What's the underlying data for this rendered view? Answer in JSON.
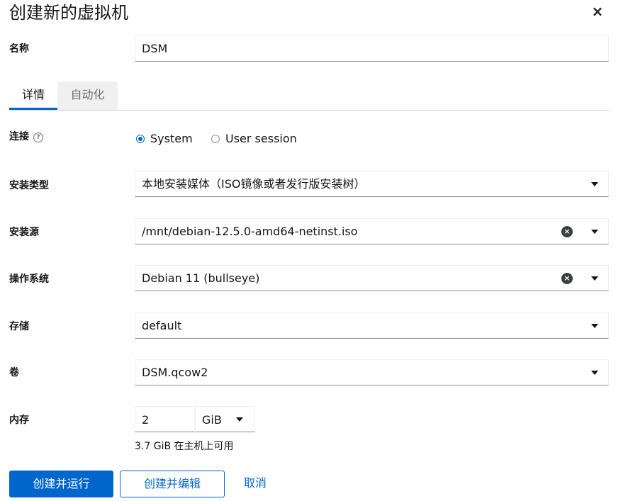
{
  "dialog": {
    "title": "创建新的虚拟机",
    "close_icon": "×"
  },
  "name": {
    "label": "名称",
    "value": "DSM"
  },
  "tabs": [
    {
      "label": "详情",
      "active": true
    },
    {
      "label": "自动化",
      "active": false
    }
  ],
  "connection": {
    "label": "连接",
    "help_icon": "?",
    "options": [
      {
        "label": "System",
        "checked": true
      },
      {
        "label": "User session",
        "checked": false
      }
    ]
  },
  "install_type": {
    "label": "安装类型",
    "value": "本地安装媒体（ISO镜像或者发行版安装树）"
  },
  "install_source": {
    "label": "安装源",
    "value": "/mnt/debian-12.5.0-amd64-netinst.iso"
  },
  "os": {
    "label": "操作系统",
    "value": "Debian 11 (bullseye)"
  },
  "storage": {
    "label": "存储",
    "value": "default"
  },
  "volume": {
    "label": "卷",
    "value": "DSM.qcow2"
  },
  "memory": {
    "label": "内存",
    "value": "2",
    "unit": "GiB",
    "helper": "3.7 GiB 在主机上可用"
  },
  "buttons": {
    "create_run": "创建并运行",
    "create_edit": "创建并编辑",
    "cancel": "取消"
  },
  "colors": {
    "accent": "#0066cc",
    "text": "#151515",
    "border": "#8a8d90"
  }
}
